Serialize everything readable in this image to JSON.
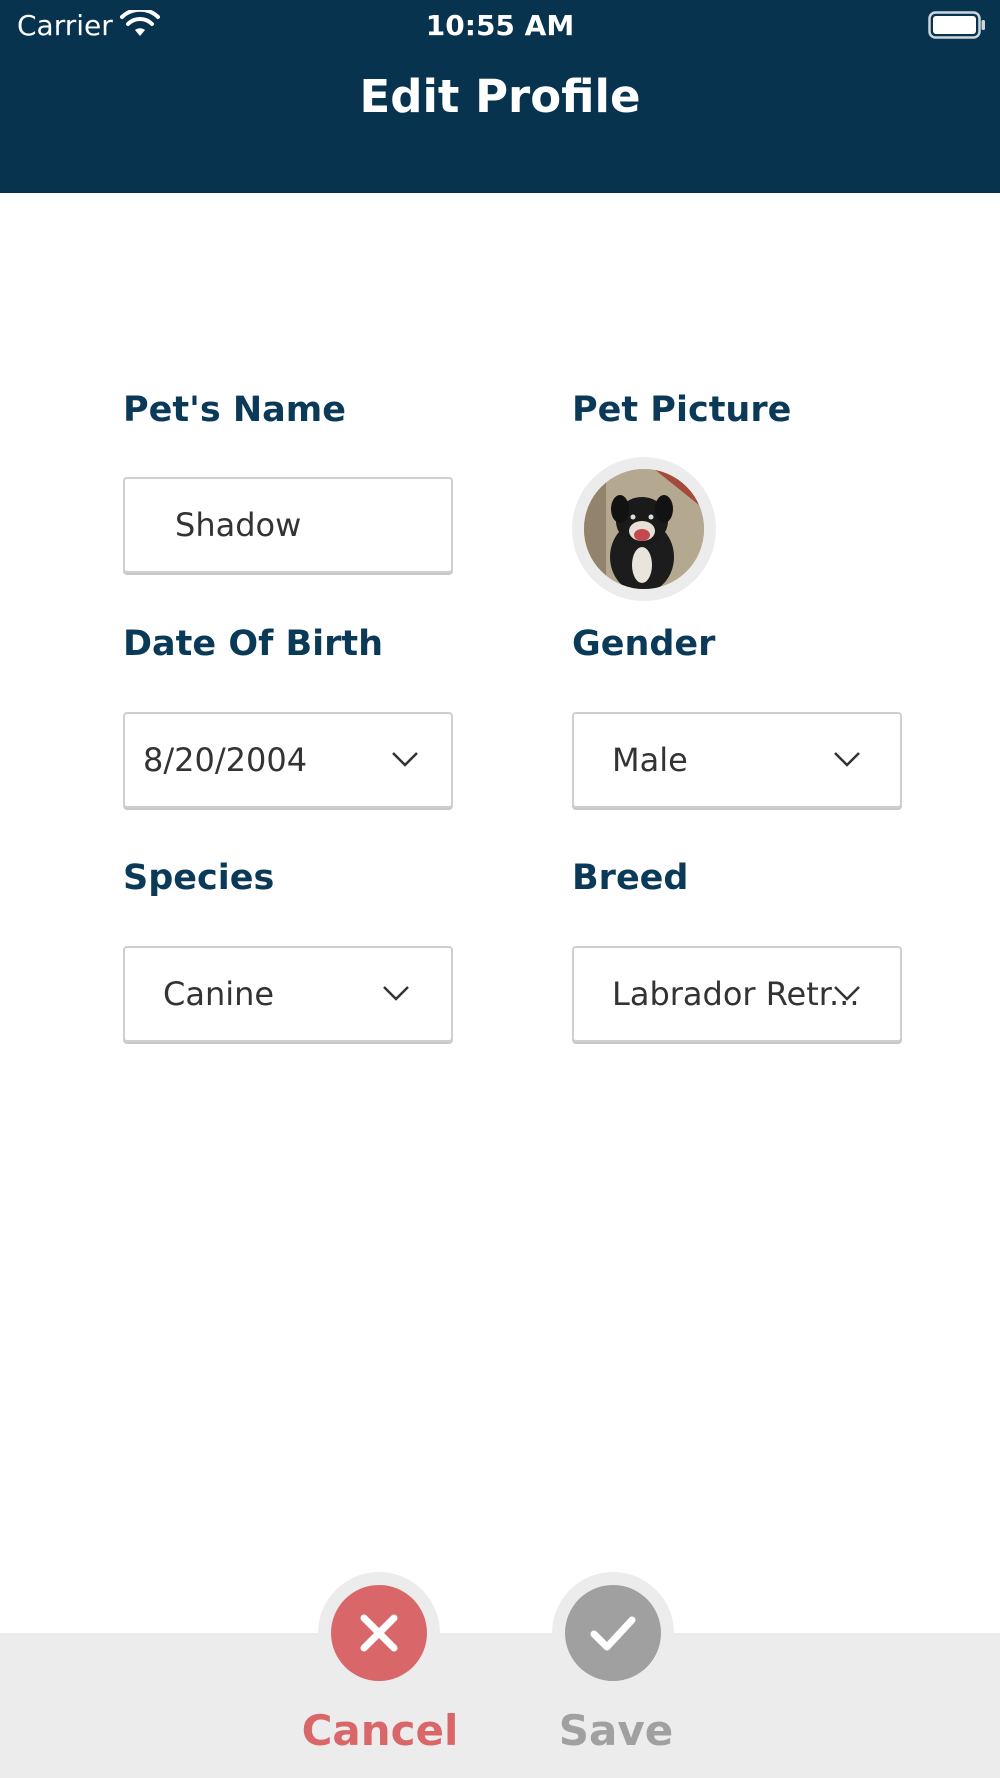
{
  "status_bar": {
    "carrier": "Carrier",
    "time": "10:55 AM",
    "wifi_icon": "wifi-icon",
    "battery_icon": "battery-icon"
  },
  "header": {
    "title": "Edit Profile",
    "background": "#07334f"
  },
  "form": {
    "pet_name": {
      "label": "Pet's Name",
      "value": "Shadow"
    },
    "pet_picture": {
      "label": "Pet Picture",
      "image": "dog-photo"
    },
    "date_of_birth": {
      "label": "Date Of Birth",
      "value": "8/20/2004"
    },
    "gender": {
      "label": "Gender",
      "value": "Male"
    },
    "species": {
      "label": "Species",
      "value": "Canine"
    },
    "breed": {
      "label": "Breed",
      "value": "Labrador Retr..."
    }
  },
  "actions": {
    "cancel": {
      "label": "Cancel",
      "color": "#d9676a",
      "icon": "close-icon"
    },
    "save": {
      "label": "Save",
      "color": "#a0a0a0",
      "icon": "checkmark-icon"
    }
  },
  "colors": {
    "label": "#0b3a58",
    "bottom_bar": "#ececec"
  }
}
